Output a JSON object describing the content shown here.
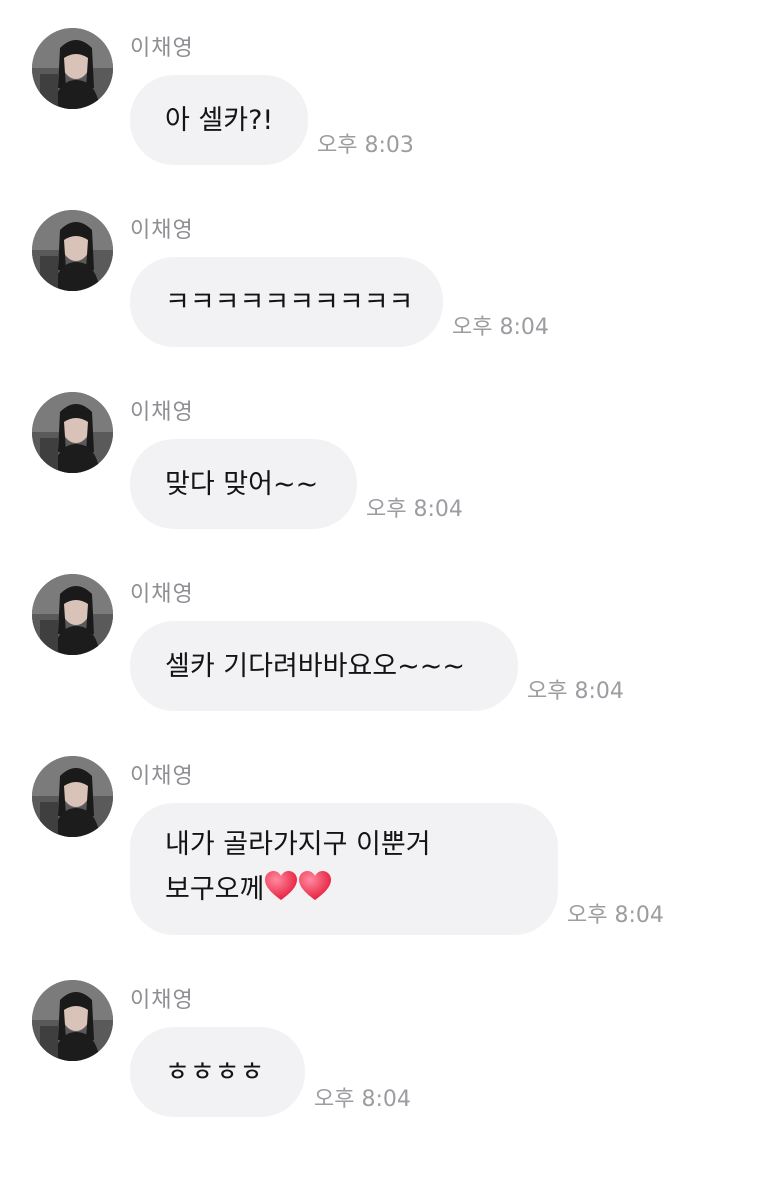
{
  "messages": [
    {
      "sender": "이채영",
      "lines": [
        "아 셀카?!"
      ],
      "time": "오후 8:03"
    },
    {
      "sender": "이채영",
      "lines": [
        "ㅋㅋㅋㅋㅋㅋㅋㅋㅋㅋ"
      ],
      "time": "오후 8:04"
    },
    {
      "sender": "이채영",
      "lines": [
        "맞다 맞어~~"
      ],
      "time": "오후 8:04"
    },
    {
      "sender": "이채영",
      "lines": [
        "셀카 기다려바바요오~~~"
      ],
      "time": "오후 8:04"
    },
    {
      "sender": "이채영",
      "lines": [
        "내가 골라가지구 이뿐거",
        "보구오께"
      ],
      "time": "오후 8:04",
      "trailing_icons": [
        "heart-icon",
        "heart-icon"
      ]
    },
    {
      "sender": "이채영",
      "lines": [
        "ㅎㅎㅎㅎ"
      ],
      "time": "오후 8:04"
    }
  ],
  "colors": {
    "bubble_bg": "#f2f2f5",
    "sender_text": "#8e8e93",
    "time_text": "#9c9ca1",
    "message_text": "#141414",
    "heart": "#f23a5c"
  }
}
